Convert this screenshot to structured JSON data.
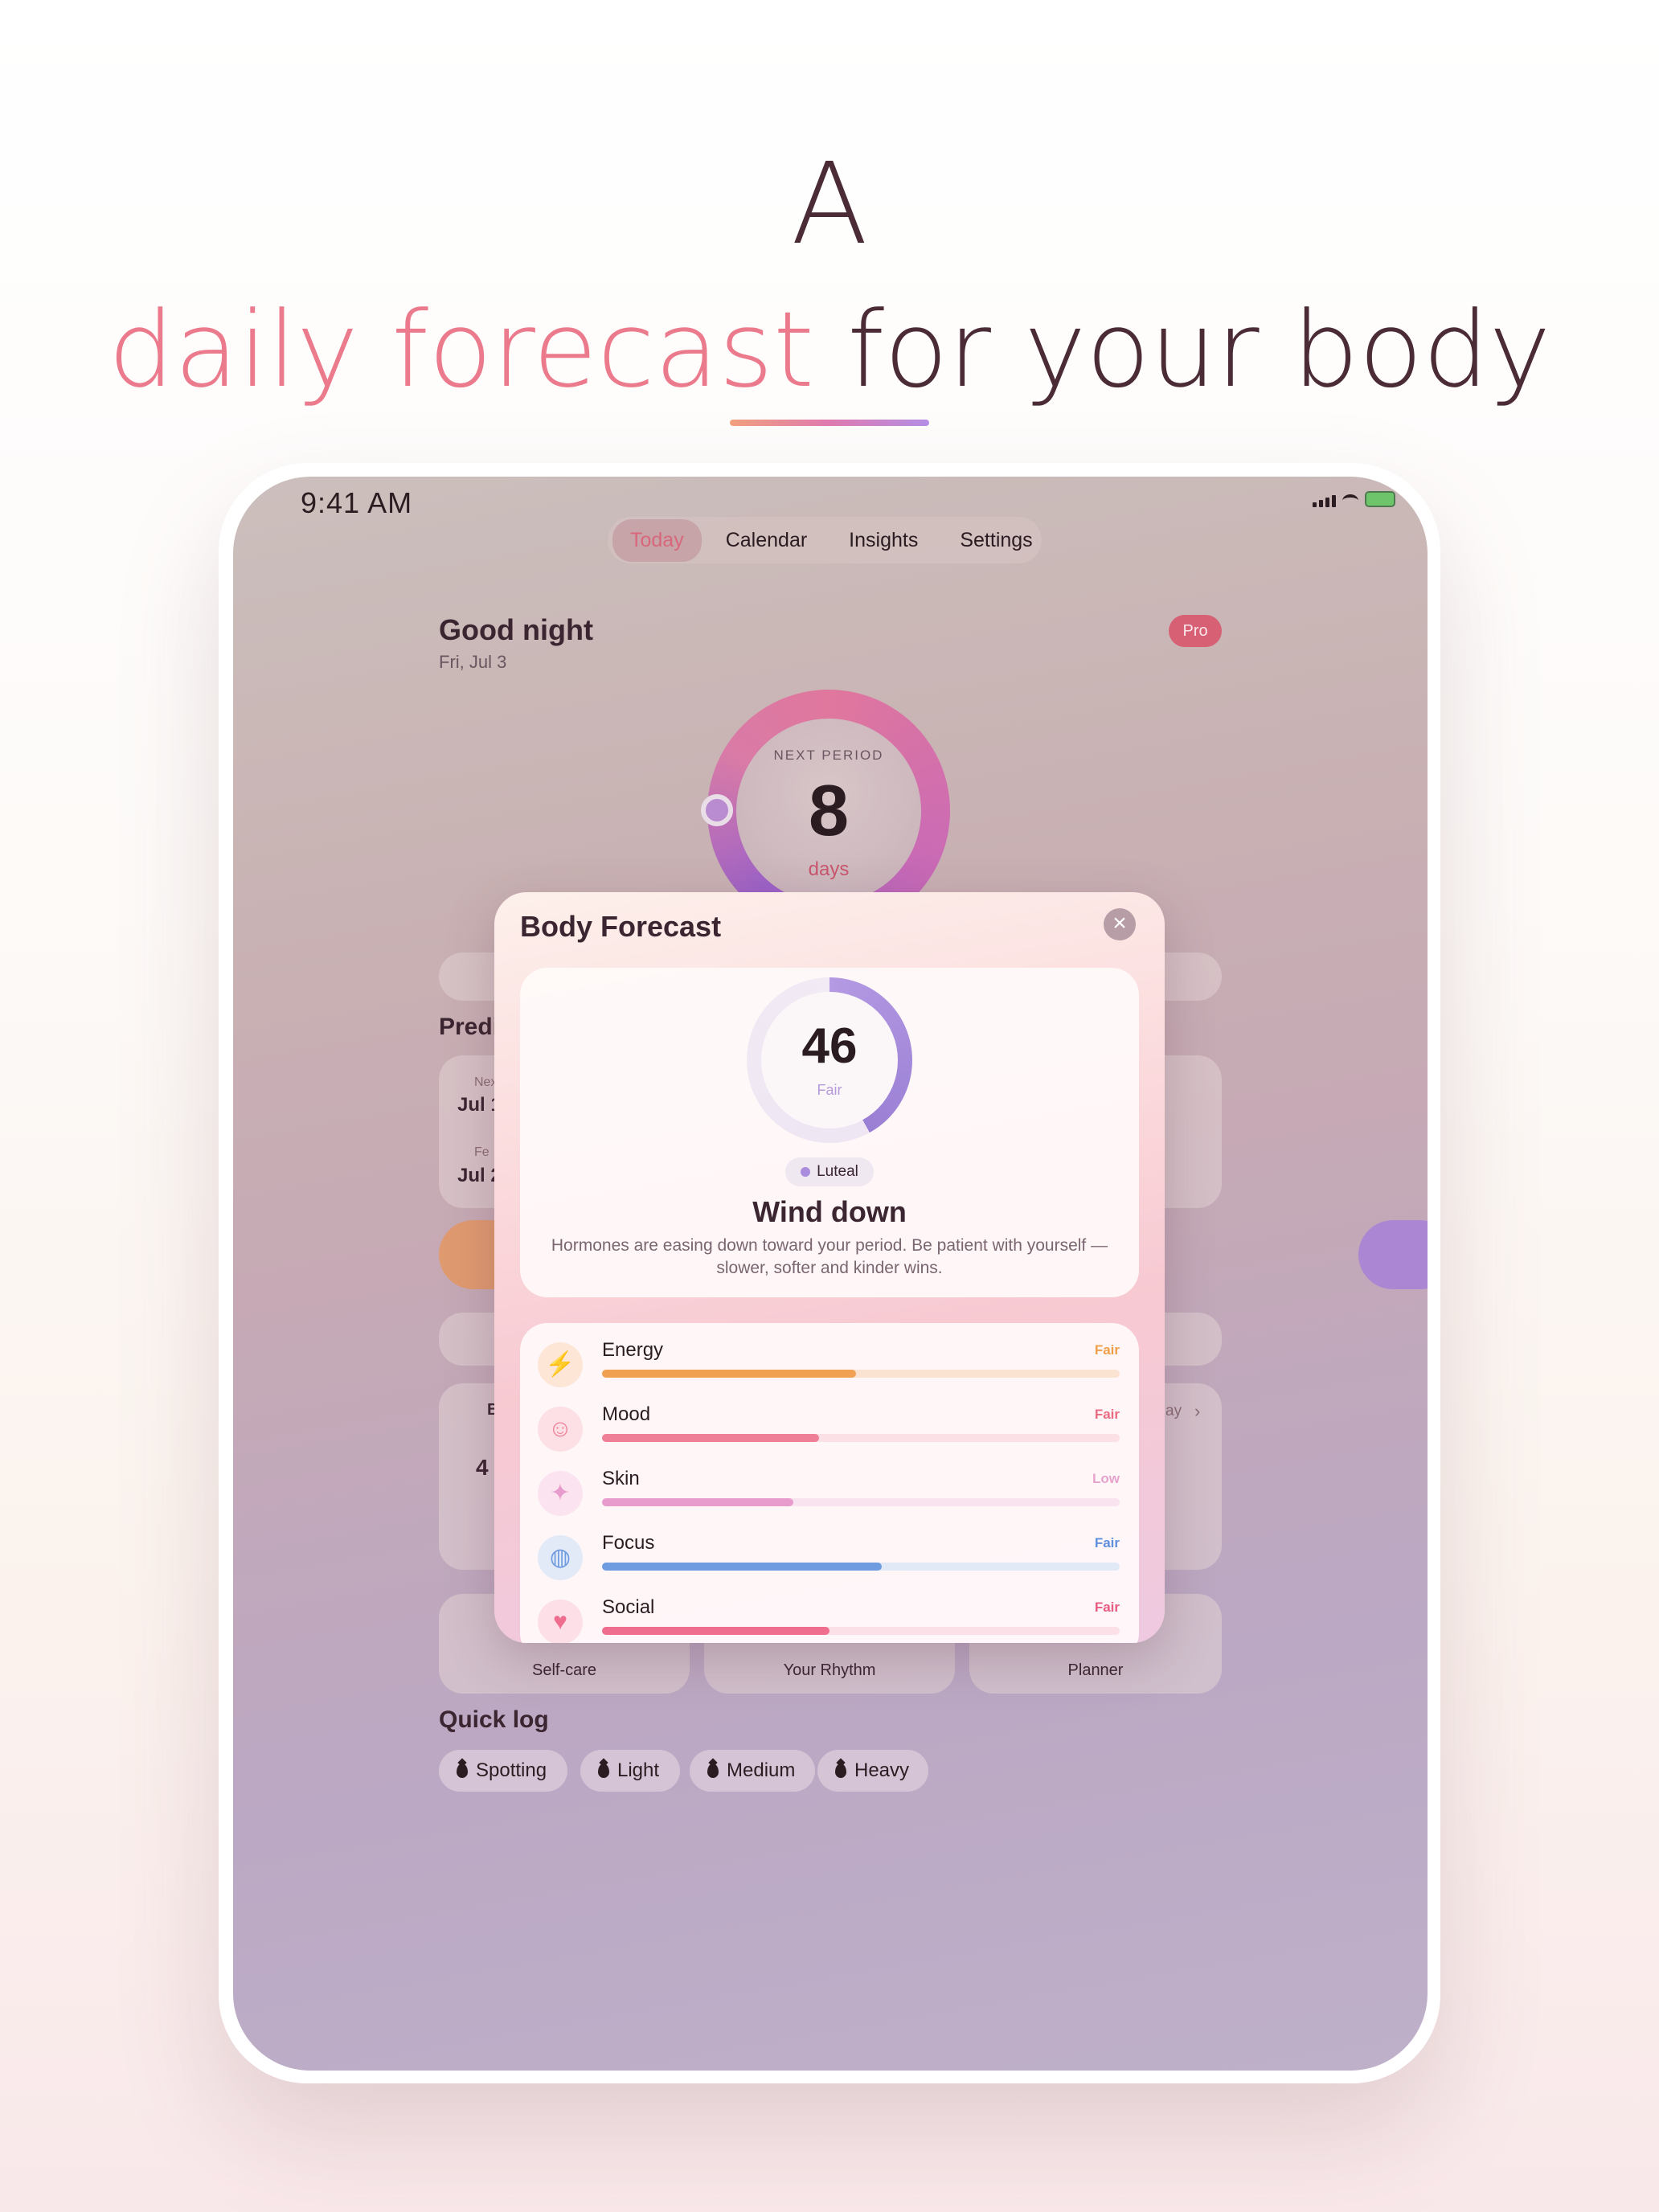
{
  "headline": {
    "line1": "A",
    "accent": "daily forecast",
    "rest": " for your body",
    "underline_colors": [
      "#f2a07f",
      "#e07bb0",
      "#b48ee6"
    ]
  },
  "status_bar": {
    "time": "9:41 AM",
    "icons": [
      "signal-icon",
      "wifi-icon",
      "battery-icon"
    ]
  },
  "tabs": [
    {
      "label": "Today",
      "active": true
    },
    {
      "label": "Calendar",
      "active": false
    },
    {
      "label": "Insights",
      "active": false
    },
    {
      "label": "Settings",
      "active": false
    }
  ],
  "header": {
    "greeting": "Good night",
    "date": "Fri, Jul 3",
    "badge": "Pro"
  },
  "period_ring": {
    "label": "NEXT PERIOD",
    "value": "8",
    "unit": "days"
  },
  "predictions": {
    "title": "Predi",
    "items": [
      {
        "small": "Nex",
        "date": "Jul 1"
      },
      {
        "small": "Fe",
        "date": "Jul 2"
      }
    ]
  },
  "background_widgets": {
    "today_link": "ay",
    "forecast_abbrev": "B",
    "forecast_score": "4"
  },
  "tiles": [
    "Self-care",
    "Your Rhythm",
    "Planner"
  ],
  "quick_log": {
    "title": "Quick log",
    "chips": [
      "Spotting",
      "Light",
      "Medium",
      "Heavy"
    ]
  },
  "modal": {
    "title": "Body Forecast",
    "close_icon": "close-icon",
    "score": "46",
    "score_label": "Fair",
    "score_fraction": 0.42,
    "phase": "Luteal",
    "headline": "Wind down",
    "description": "Hormones are easing down toward your period. Be patient with yourself — slower, softer and kinder wins.",
    "metrics": [
      {
        "name": "Energy",
        "level": "Fair",
        "value": 0.49,
        "icon": "lightning-icon",
        "color": "#f0a252",
        "track": "#fbe3d2",
        "icon_bg": "#fde6d6",
        "level_color": "#ef9f47"
      },
      {
        "name": "Mood",
        "level": "Fair",
        "value": 0.42,
        "icon": "smile-icon",
        "color": "#ef7f96",
        "track": "#fbe0e5",
        "icon_bg": "#fde0e6",
        "level_color": "#e96a82"
      },
      {
        "name": "Skin",
        "level": "Low",
        "value": 0.37,
        "icon": "sparkle-icon",
        "color": "#e89bcd",
        "track": "#f8e3ef",
        "icon_bg": "#fbe3f0",
        "level_color": "#e6a3cc"
      },
      {
        "name": "Focus",
        "level": "Fair",
        "value": 0.54,
        "icon": "brain-icon",
        "color": "#6f9ce0",
        "track": "#e2e9f6",
        "icon_bg": "#e2eaf8",
        "level_color": "#5f90dc"
      },
      {
        "name": "Social",
        "level": "Fair",
        "value": 0.44,
        "icon": "heart-icon",
        "color": "#ef6e8f",
        "track": "#fbe1e7",
        "icon_bg": "#fde0e7",
        "level_color": "#e85a80"
      }
    ]
  }
}
